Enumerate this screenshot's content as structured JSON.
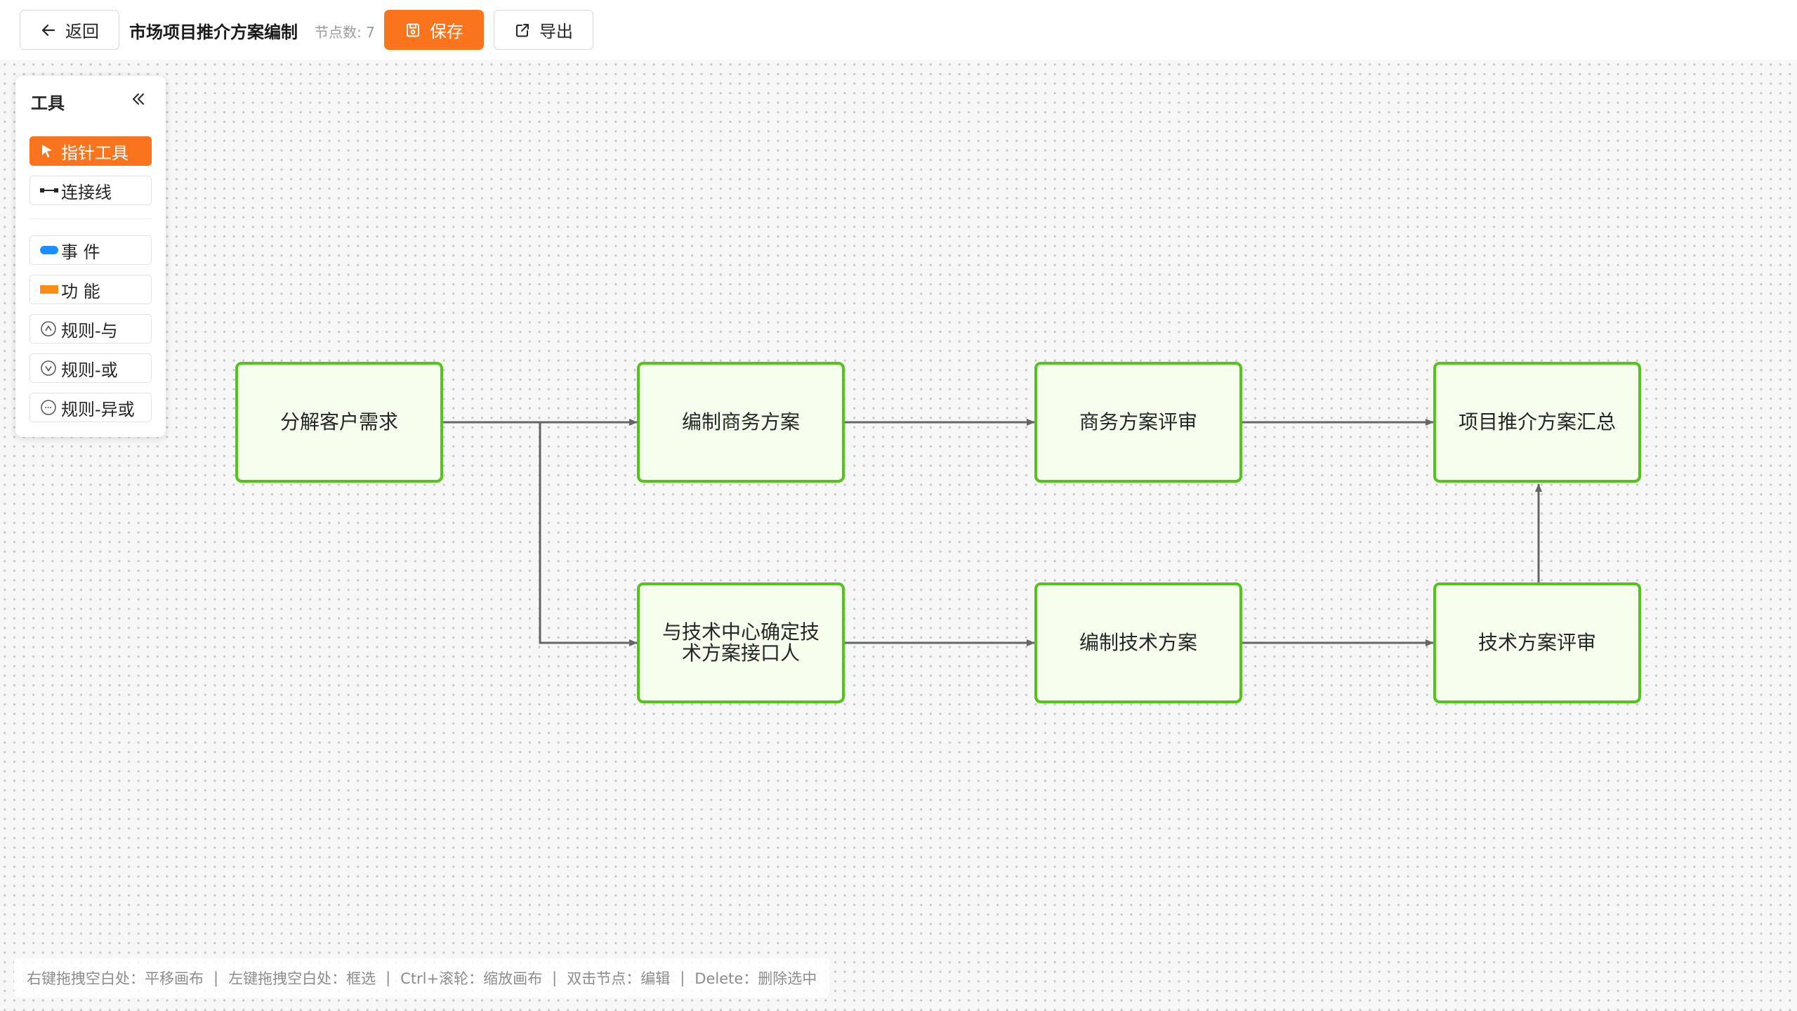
{
  "toolbar": {
    "back_label": "返回",
    "title": "市场项目推介方案编制",
    "node_count": "节点数: 7",
    "save_label": "保存",
    "export_label": "导出"
  },
  "panel": {
    "title": "工具",
    "tools": [
      {
        "label": "指针工具",
        "icon": "pointer-arrow-icon",
        "active": true
      },
      {
        "label": "连接线",
        "icon": "connector-line-icon",
        "active": false
      }
    ],
    "shapes": [
      {
        "label": "事 件",
        "icon": "event-blue-pill-icon",
        "color": "#1890ff"
      },
      {
        "label": "功 能",
        "icon": "function-orange-rect-icon",
        "color": "#fa8c16"
      },
      {
        "label": "规则-与",
        "icon": "rule-and-circle-icon"
      },
      {
        "label": "规则-或",
        "icon": "rule-or-circle-icon"
      },
      {
        "label": "规则-异或",
        "icon": "rule-xor-circle-icon"
      }
    ]
  },
  "diagram": {
    "nodes": [
      {
        "id": "n1",
        "label": "分解客户需求"
      },
      {
        "id": "n2",
        "label": "编制商务方案"
      },
      {
        "id": "n3",
        "label": "商务方案评审"
      },
      {
        "id": "n4",
        "label": "项目推介方案汇总"
      },
      {
        "id": "n5",
        "label": "与技术中心确定技术方案接口人"
      },
      {
        "id": "n6",
        "label": "编制技术方案"
      },
      {
        "id": "n7",
        "label": "技术方案评审"
      }
    ],
    "edges": [
      {
        "from": "n1",
        "to": "n2"
      },
      {
        "from": "n2",
        "to": "n3"
      },
      {
        "from": "n3",
        "to": "n4"
      },
      {
        "from": "n1",
        "to": "n5"
      },
      {
        "from": "n5",
        "to": "n6"
      },
      {
        "from": "n6",
        "to": "n7"
      },
      {
        "from": "n7",
        "to": "n4"
      }
    ],
    "node_fill": "#f6ffed",
    "node_border": "#52c41a",
    "edge_color": "#666666"
  },
  "hints": [
    "右键拖拽空白处：平移画布",
    "左键拖拽空白处：框选",
    "Ctrl+滚轮：缩放画布",
    "双击节点：编辑",
    "Delete：删除选中"
  ],
  "hint_separator": "|"
}
